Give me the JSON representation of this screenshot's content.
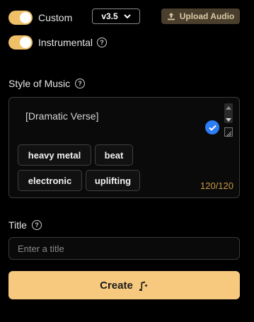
{
  "toggles": {
    "custom": {
      "label": "Custom",
      "on": true
    },
    "instrumental": {
      "label": "Instrumental",
      "on": true
    }
  },
  "version": {
    "selected": "v3.5"
  },
  "upload": {
    "label": "Upload Audio"
  },
  "style": {
    "heading": "Style of Music",
    "text": "[Dramatic Verse]",
    "tags": [
      "heavy metal",
      "beat",
      "electronic",
      "uplifting"
    ],
    "counter": "120/120"
  },
  "title": {
    "heading": "Title",
    "placeholder": "Enter a title",
    "value": ""
  },
  "create": {
    "label": "Create"
  },
  "colors": {
    "accent": "#f6c97f",
    "toggle": "#f0c068",
    "counter": "#c99a45",
    "check": "#2d7df6"
  }
}
